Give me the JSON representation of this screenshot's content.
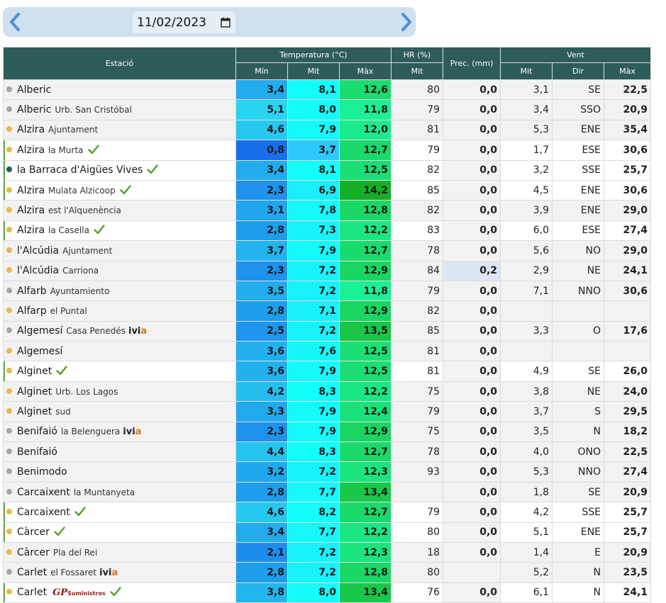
{
  "nav": {
    "date": "11/02/2023",
    "prev_icon": "chevron-left-icon",
    "next_icon": "chevron-right-icon"
  },
  "headers": {
    "station": "Estació",
    "temperature": "Temperatura (°C)",
    "humidity": "HR (%)",
    "precipitation": "Prec. (mm)",
    "wind": "Vent",
    "t_min": "Mín",
    "t_mit": "Mit",
    "t_max": "Màx",
    "hr_mit": "Mit",
    "w_mit": "Mit",
    "w_dir": "Dir",
    "w_max": "Màx"
  },
  "colors": {
    "dot_grey": "#a6a6a6",
    "dot_yellow": "#e8b84b",
    "dot_teal": "#1f5f5f",
    "check_green": "#5a9e2f"
  },
  "rows": [
    {
      "name": "Alberic",
      "sub": "",
      "dot": "grey",
      "check": false,
      "flag": false,
      "tmin": "3,4",
      "tmit": "8,1",
      "tmax": "12,6",
      "hr": "80",
      "prec": "0,0",
      "wmit": "3,1",
      "wdir": "SE",
      "wmax": "22,5"
    },
    {
      "name": "Alberic",
      "sub": "Urb. San Cristóbal",
      "dot": "grey",
      "check": false,
      "flag": false,
      "tmin": "5,1",
      "tmit": "8,0",
      "tmax": "11,8",
      "hr": "79",
      "prec": "0,0",
      "wmit": "3,4",
      "wdir": "SSO",
      "wmax": "20,9"
    },
    {
      "name": "Alzira",
      "sub": "Ajuntament",
      "dot": "yellow",
      "check": false,
      "flag": false,
      "tmin": "4,6",
      "tmit": "7,9",
      "tmax": "12,0",
      "hr": "81",
      "prec": "0,0",
      "wmit": "5,3",
      "wdir": "ENE",
      "wmax": "35,4"
    },
    {
      "name": "Alzira",
      "sub": "la Murta",
      "dot": "yellow",
      "check": true,
      "flag": true,
      "tmin": "0,8",
      "tmit": "3,7",
      "tmax": "12,7",
      "hr": "79",
      "prec": "0,0",
      "wmit": "1,7",
      "wdir": "ESE",
      "wmax": "30,6"
    },
    {
      "name": "la Barraca d'Aigües Vives",
      "sub": "",
      "dot": "teal",
      "check": true,
      "flag": true,
      "tmin": "3,4",
      "tmit": "8,1",
      "tmax": "12,5",
      "hr": "82",
      "prec": "0,0",
      "wmit": "3,2",
      "wdir": "SSE",
      "wmax": "25,7"
    },
    {
      "name": "Alzira",
      "sub": "Mulata Alzicoop",
      "dot": "yellow",
      "check": true,
      "flag": true,
      "tmin": "2,3",
      "tmit": "6,9",
      "tmax": "14,2",
      "hr": "85",
      "prec": "0,0",
      "wmit": "4,5",
      "wdir": "ENE",
      "wmax": "30,6"
    },
    {
      "name": "Alzira",
      "sub": "est l'Alquenència",
      "dot": "yellow",
      "check": false,
      "flag": false,
      "tmin": "3,1",
      "tmit": "7,8",
      "tmax": "12,8",
      "hr": "82",
      "prec": "0,0",
      "wmit": "3,9",
      "wdir": "ENE",
      "wmax": "29,0"
    },
    {
      "name": "Alzira",
      "sub": "la Casella",
      "dot": "yellow",
      "check": true,
      "flag": true,
      "tmin": "2,8",
      "tmit": "7,3",
      "tmax": "12,2",
      "hr": "83",
      "prec": "0,0",
      "wmit": "6,0",
      "wdir": "ESE",
      "wmax": "27,4"
    },
    {
      "name": "l'Alcúdia",
      "sub": "Ajuntament",
      "dot": "yellow",
      "check": false,
      "flag": false,
      "tmin": "3,7",
      "tmit": "7,9",
      "tmax": "12,7",
      "hr": "78",
      "prec": "0,0",
      "wmit": "5,6",
      "wdir": "NO",
      "wmax": "29,0"
    },
    {
      "name": "l'Alcúdia",
      "sub": "Carriona",
      "dot": "yellow",
      "check": false,
      "flag": false,
      "tmin": "2,3",
      "tmit": "7,2",
      "tmax": "12,9",
      "hr": "84",
      "prec": "0,2",
      "wmit": "2,9",
      "wdir": "NE",
      "wmax": "24,1"
    },
    {
      "name": "Alfarb",
      "sub": "Ayuntamiento",
      "dot": "grey",
      "check": false,
      "flag": false,
      "tmin": "3,5",
      "tmit": "7,2",
      "tmax": "11,8",
      "hr": "79",
      "prec": "0,0",
      "wmit": "7,1",
      "wdir": "NNO",
      "wmax": "30,6"
    },
    {
      "name": "Alfarp",
      "sub": "el Puntal",
      "dot": "yellow",
      "check": false,
      "flag": false,
      "tmin": "2,8",
      "tmit": "7,1",
      "tmax": "12,9",
      "hr": "82",
      "prec": "0,0",
      "wmit": "",
      "wdir": "",
      "wmax": ""
    },
    {
      "name": "Algemesí",
      "sub": "Casa Penedés",
      "dot": "grey",
      "check": false,
      "flag": false,
      "ivia": true,
      "tmin": "2,5",
      "tmit": "7,2",
      "tmax": "13,5",
      "hr": "85",
      "prec": "0,0",
      "wmit": "3,3",
      "wdir": "O",
      "wmax": "17,6"
    },
    {
      "name": "Algemesí",
      "sub": "",
      "dot": "yellow",
      "check": false,
      "flag": false,
      "tmin": "3,6",
      "tmit": "7,6",
      "tmax": "12,5",
      "hr": "81",
      "prec": "0,0",
      "wmit": "",
      "wdir": "",
      "wmax": ""
    },
    {
      "name": "Alginet",
      "sub": "",
      "dot": "yellow",
      "check": true,
      "flag": true,
      "tmin": "3,6",
      "tmit": "7,9",
      "tmax": "12,5",
      "hr": "81",
      "prec": "0,0",
      "wmit": "4,9",
      "wdir": "SE",
      "wmax": "26,0"
    },
    {
      "name": "Alginet",
      "sub": "Urb. Los Lagos",
      "dot": "yellow",
      "check": false,
      "flag": false,
      "tmin": "4,2",
      "tmit": "8,3",
      "tmax": "12,2",
      "hr": "75",
      "prec": "0,0",
      "wmit": "3,8",
      "wdir": "NE",
      "wmax": "24,0"
    },
    {
      "name": "Alginet",
      "sub": "sud",
      "dot": "yellow",
      "check": false,
      "flag": false,
      "tmin": "3,3",
      "tmit": "7,9",
      "tmax": "12,4",
      "hr": "79",
      "prec": "0,0",
      "wmit": "3,7",
      "wdir": "S",
      "wmax": "29,5"
    },
    {
      "name": "Benifaió",
      "sub": "la Belenguera",
      "dot": "grey",
      "check": false,
      "flag": false,
      "ivia": true,
      "tmin": "2,3",
      "tmit": "7,9",
      "tmax": "12,9",
      "hr": "75",
      "prec": "0,0",
      "wmit": "3,5",
      "wdir": "N",
      "wmax": "18,2"
    },
    {
      "name": "Benifaió",
      "sub": "",
      "dot": "grey",
      "check": false,
      "flag": false,
      "tmin": "4,4",
      "tmit": "8,3",
      "tmax": "12,7",
      "hr": "78",
      "prec": "0,0",
      "wmit": "4,0",
      "wdir": "ONO",
      "wmax": "22,5"
    },
    {
      "name": "Benimodo",
      "sub": "",
      "dot": "grey",
      "check": false,
      "flag": false,
      "tmin": "3,2",
      "tmit": "7,2",
      "tmax": "12,3",
      "hr": "93",
      "prec": "0,0",
      "wmit": "5,3",
      "wdir": "NNO",
      "wmax": "27,4"
    },
    {
      "name": "Carcaixent",
      "sub": "la Muntanyeta",
      "dot": "grey",
      "check": false,
      "flag": false,
      "tmin": "2,8",
      "tmit": "7,7",
      "tmax": "13,4",
      "hr": "",
      "prec": "0,0",
      "wmit": "1,8",
      "wdir": "SE",
      "wmax": "20,9"
    },
    {
      "name": "Carcaixent",
      "sub": "",
      "dot": "yellow",
      "check": true,
      "flag": true,
      "tmin": "4,6",
      "tmit": "8,2",
      "tmax": "12,7",
      "hr": "79",
      "prec": "0,0",
      "wmit": "4,2",
      "wdir": "SSE",
      "wmax": "25,7"
    },
    {
      "name": "Càrcer",
      "sub": "",
      "dot": "yellow",
      "check": true,
      "flag": true,
      "tmin": "3,4",
      "tmit": "7,7",
      "tmax": "12,2",
      "hr": "80",
      "prec": "0,0",
      "wmit": "5,1",
      "wdir": "ENE",
      "wmax": "25,7"
    },
    {
      "name": "Càrcer",
      "sub": "Pla del Rei",
      "dot": "yellow",
      "check": false,
      "flag": false,
      "tmin": "2,1",
      "tmit": "7,2",
      "tmax": "12,3",
      "hr": "18",
      "prec": "0,0",
      "wmit": "1,4",
      "wdir": "E",
      "wmax": "20,9"
    },
    {
      "name": "Carlet",
      "sub": "el Fossaret",
      "dot": "grey",
      "check": false,
      "flag": false,
      "ivia": true,
      "tmin": "2,8",
      "tmit": "7,2",
      "tmax": "12,8",
      "hr": "80",
      "prec": "",
      "wmit": "5,2",
      "wdir": "N",
      "wmax": "23,5"
    },
    {
      "name": "Carlet",
      "sub": "",
      "dot": "yellow",
      "check": true,
      "flag": true,
      "gp": true,
      "tmin": "3,8",
      "tmit": "8,0",
      "tmax": "13,4",
      "hr": "76",
      "prec": "0,0",
      "wmit": "6,1",
      "wdir": "N",
      "wmax": "24,1"
    }
  ],
  "logos": {
    "ivia_i": "ivi",
    "ivia_a": "a",
    "gp_big": "GP",
    "gp_small": "Suministros"
  }
}
